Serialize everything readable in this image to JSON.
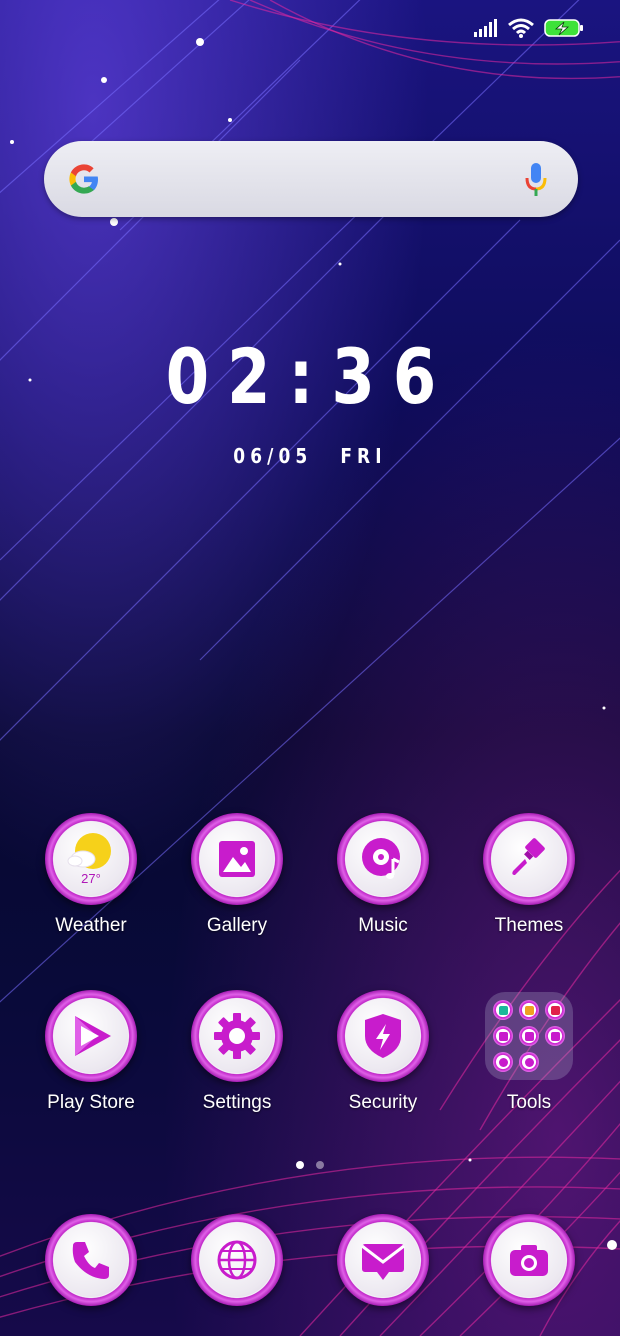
{
  "status_bar": {
    "signal_icon": "signal-icon",
    "wifi_icon": "wifi-icon",
    "battery_icon": "battery-charging-icon",
    "battery_color": "#3ee23a"
  },
  "search": {
    "logo": "google-logo",
    "mic_icon": "mic-icon"
  },
  "clock": {
    "time": "02:36",
    "date": "06/05",
    "weekday": "FRI"
  },
  "apps": [
    {
      "label": "Weather",
      "icon": "weather-icon",
      "temp": "27°"
    },
    {
      "label": "Gallery",
      "icon": "gallery-icon"
    },
    {
      "label": "Music",
      "icon": "music-icon"
    },
    {
      "label": "Themes",
      "icon": "brush-icon"
    },
    {
      "label": "Play Store",
      "icon": "play-store-icon"
    },
    {
      "label": "Settings",
      "icon": "gear-icon"
    },
    {
      "label": "Security",
      "icon": "shield-icon"
    },
    {
      "label": "Tools",
      "icon": "folder-icon"
    }
  ],
  "dock": [
    {
      "icon": "phone-icon"
    },
    {
      "icon": "browser-icon"
    },
    {
      "icon": "messages-icon"
    },
    {
      "icon": "camera-icon"
    }
  ],
  "pages": {
    "count": 2,
    "current": 1
  },
  "theme": {
    "accent": "#c81ccc",
    "accent_light": "#e46cec"
  }
}
